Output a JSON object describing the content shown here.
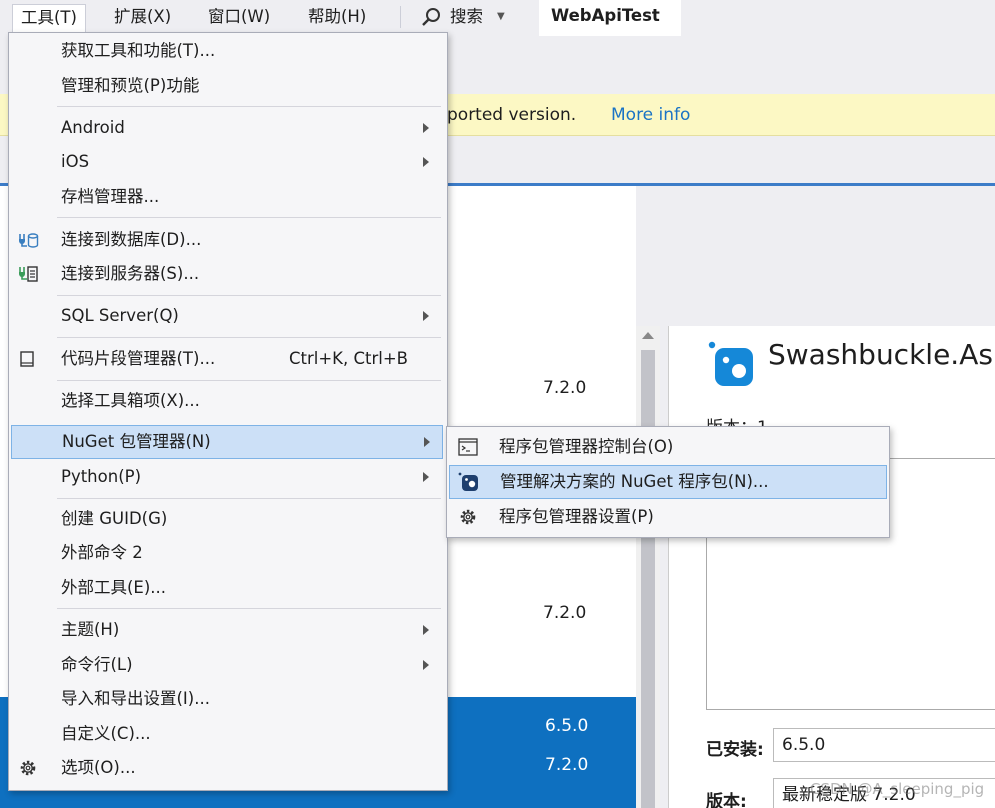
{
  "menubar": {
    "items": [
      "工具(T)",
      "扩展(X)",
      "窗口(W)",
      "帮助(H)"
    ],
    "search_label": "搜索",
    "window_title": "WebApiTest"
  },
  "infobar": {
    "text": "ported version.",
    "link": "More info"
  },
  "package_list": {
    "versions": [
      "7.2.0",
      "7.2.0",
      "6.5.0",
      "7.2.0"
    ]
  },
  "details": {
    "package_name": "Swashbuckle.As",
    "version_partial": "版本：1",
    "installed_label": "已安装:",
    "installed_value": "6.5.0",
    "version_label": "版本:",
    "version_value": "最新稳定版 7.2.0"
  },
  "tools_menu": {
    "items": [
      {
        "label": "获取工具和功能(T)..."
      },
      {
        "label": "管理和预览(P)功能"
      },
      {
        "label": "Android"
      },
      {
        "label": "iOS"
      },
      {
        "label": "存档管理器..."
      },
      {
        "label": "连接到数据库(D)..."
      },
      {
        "label": "连接到服务器(S)..."
      },
      {
        "label": "SQL Server(Q)"
      },
      {
        "label": "代码片段管理器(T)...",
        "shortcut": "Ctrl+K, Ctrl+B"
      },
      {
        "label": "选择工具箱项(X)..."
      },
      {
        "label": "NuGet 包管理器(N)"
      },
      {
        "label": "Python(P)"
      },
      {
        "label": "创建 GUID(G)"
      },
      {
        "label": "外部命令 2"
      },
      {
        "label": "外部工具(E)..."
      },
      {
        "label": "主题(H)"
      },
      {
        "label": "命令行(L)"
      },
      {
        "label": "导入和导出设置(I)..."
      },
      {
        "label": "自定义(C)..."
      },
      {
        "label": "选项(O)..."
      }
    ]
  },
  "nuget_submenu": {
    "items": [
      {
        "label": "程序包管理器控制台(O)"
      },
      {
        "label": "管理解决方案的 NuGet 程序包(N)..."
      },
      {
        "label": "程序包管理器设置(P)"
      }
    ]
  },
  "watermark": "CSDN @A_sleeping_pig",
  "colors": {
    "accent": "#0e70c0",
    "menu_highlight": "#cce0f7",
    "infobar": "#fcf8c4",
    "link": "#1a73c5"
  }
}
